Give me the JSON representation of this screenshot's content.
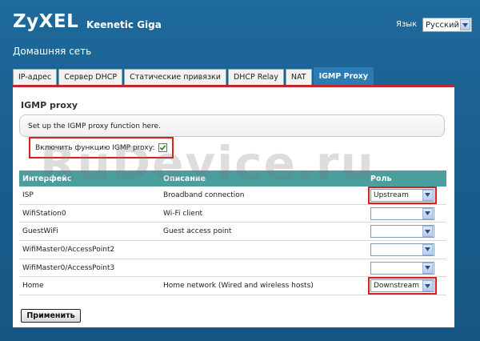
{
  "header": {
    "brand": "ZyXEL",
    "model": "Keenetic Giga",
    "language_label": "Язык",
    "language_value": "Русский",
    "page_title": "Домашняя сеть"
  },
  "tabs": [
    {
      "label": "IP-адрес"
    },
    {
      "label": "Сервер DHCP"
    },
    {
      "label": "Статические привязки"
    },
    {
      "label": "DHCP Relay"
    },
    {
      "label": "NAT"
    },
    {
      "label": "IGMP Proxy"
    }
  ],
  "section": {
    "title": "IGMP proxy",
    "description": "Set up the IGMP proxy function here.",
    "enable_label": "Включить функцию IGMP proxy:",
    "enable_checked": true
  },
  "table": {
    "headers": {
      "interface": "Интерфейс",
      "description": "Описание",
      "role": "Роль"
    },
    "rows": [
      {
        "interface": "ISP",
        "description": "Broadband connection",
        "role": "Upstream"
      },
      {
        "interface": "WifiStation0",
        "description": "Wi-Fi client",
        "role": ""
      },
      {
        "interface": "GuestWiFi",
        "description": "Guest access point",
        "role": ""
      },
      {
        "interface": "WifiMaster0/AccessPoint2",
        "description": "",
        "role": ""
      },
      {
        "interface": "WifiMaster0/AccessPoint3",
        "description": "",
        "role": ""
      },
      {
        "interface": "Home",
        "description": "Home network (Wired and wireless hosts)",
        "role": "Downstream"
      }
    ]
  },
  "apply_label": "Применить",
  "watermark": "RuDevice.ru",
  "watermark_corner": "RuDevice.ru"
}
